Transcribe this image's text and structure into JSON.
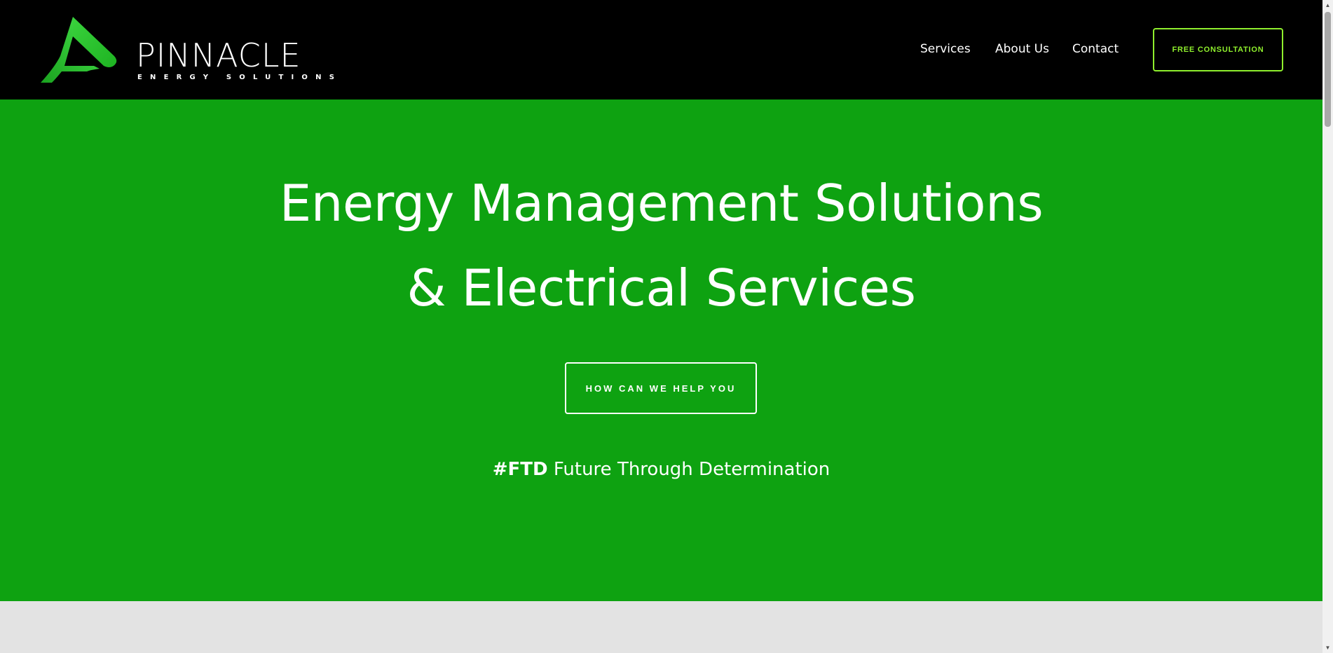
{
  "brand": {
    "name": "PINNACLE",
    "tagline": "ENERGY SOLUTIONS",
    "logo_icon": "pinnacle-logo-icon",
    "accent_color": "#8fef2d",
    "hero_color": "#0ea211",
    "header_color": "#000000"
  },
  "nav": {
    "items": [
      {
        "label": "Services"
      },
      {
        "label": "About Us"
      },
      {
        "label": "Contact"
      }
    ],
    "cta_label": "FREE CONSULTATION"
  },
  "hero": {
    "title_line1": "Energy Management Solutions",
    "title_line2": "& Electrical Services",
    "button_label": "HOW CAN WE HELP YOU",
    "motto_hashtag": "#FTD",
    "motto_text": " Future Through Determination"
  },
  "scrollbar": {
    "up_icon": "scroll-up-arrow-icon",
    "down_icon": "scroll-down-arrow-icon"
  }
}
